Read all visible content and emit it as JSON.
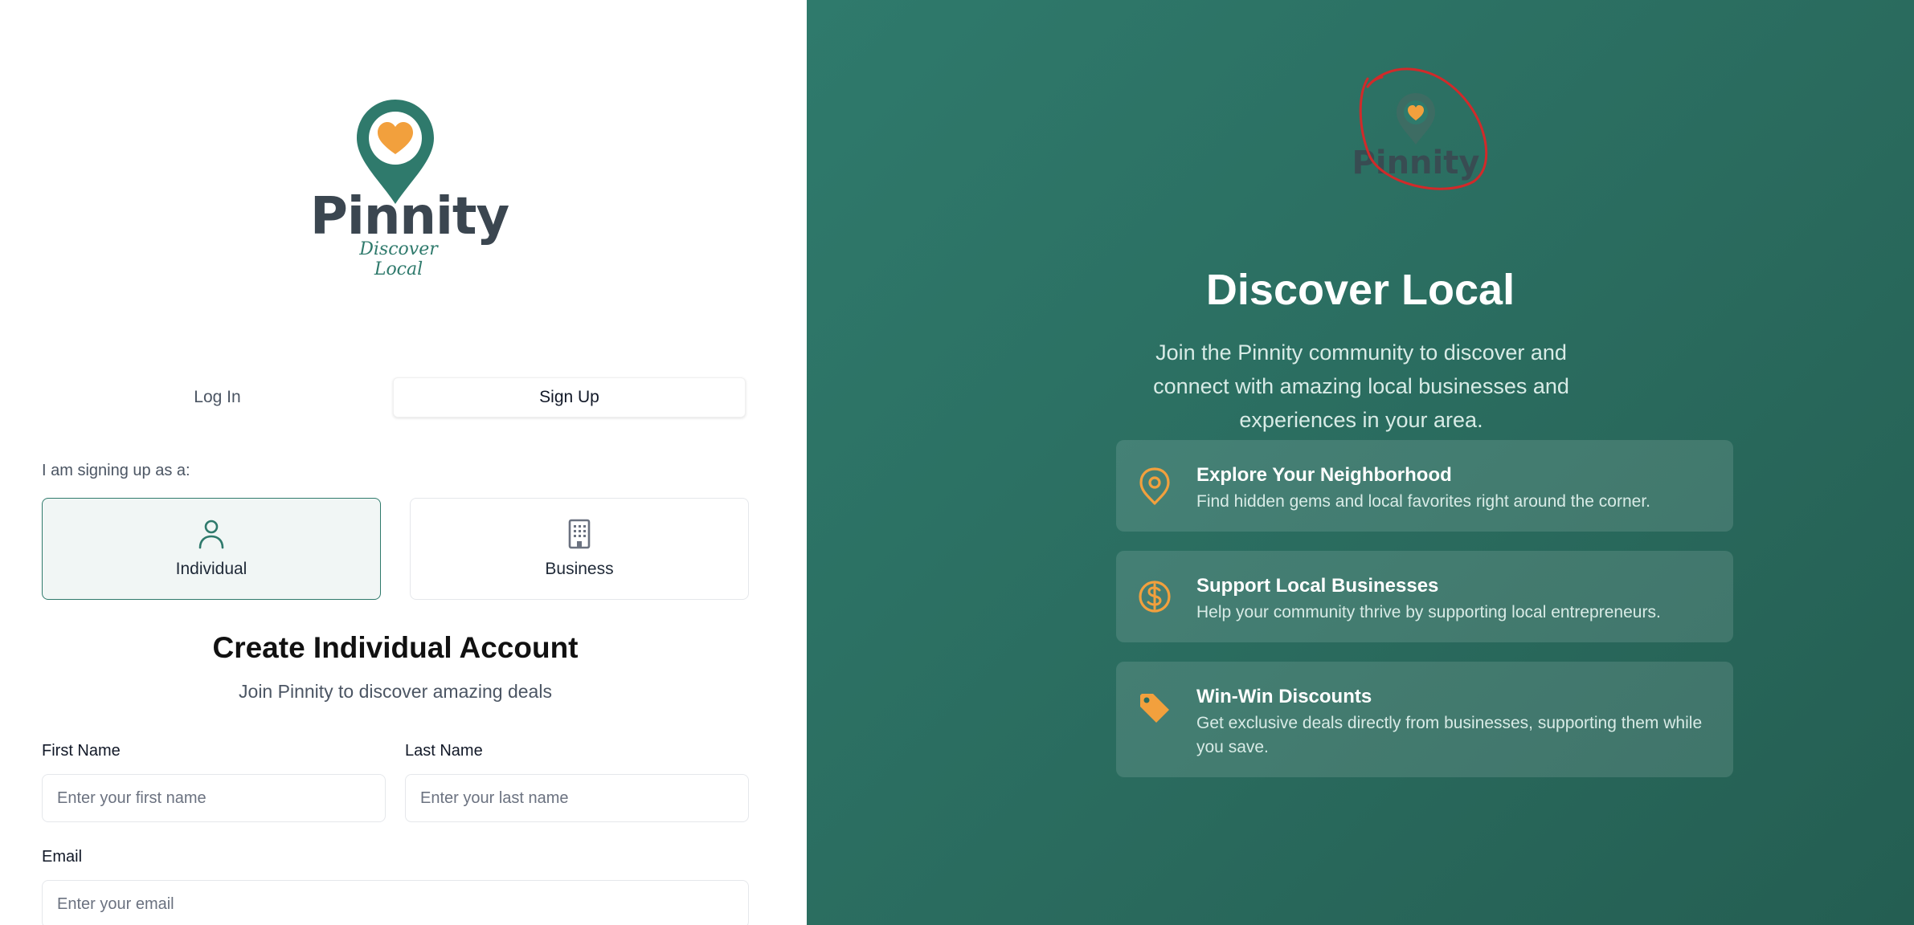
{
  "brand": {
    "name": "Pinnity",
    "tagline": "Discover Local",
    "colors": {
      "primary": "#2f7a6c",
      "accent": "#f2a03d",
      "text": "#3b4650",
      "annotation": "#d12a2a"
    }
  },
  "auth_tabs": {
    "login_label": "Log In",
    "signup_label": "Sign Up",
    "active": "signup"
  },
  "signup": {
    "role_prompt": "I am signing up as a:",
    "roles": [
      {
        "label": "Individual",
        "icon": "user-icon",
        "selected": true
      },
      {
        "label": "Business",
        "icon": "building-icon",
        "selected": false
      }
    ],
    "title": "Create Individual Account",
    "subtitle": "Join Pinnity to discover amazing deals",
    "fields": {
      "first_name": {
        "label": "First Name",
        "placeholder": "Enter your first name",
        "value": ""
      },
      "last_name": {
        "label": "Last Name",
        "placeholder": "Enter your last name",
        "value": ""
      },
      "email": {
        "label": "Email",
        "placeholder": "Enter your email",
        "value": ""
      }
    }
  },
  "hero": {
    "logo_word": "Pinnity",
    "title": "Discover Local",
    "description": "Join the Pinnity community to discover and connect with amazing local businesses and experiences in your area.",
    "features": [
      {
        "icon": "map-pin-icon",
        "title": "Explore Your Neighborhood",
        "description": "Find hidden gems and local favorites right around the corner."
      },
      {
        "icon": "dollar-circle-icon",
        "title": "Support Local Businesses",
        "description": "Help your community thrive by supporting local entrepreneurs."
      },
      {
        "icon": "tag-icon",
        "title": "Win-Win Discounts",
        "description": "Get exclusive deals directly from businesses, supporting them while you save."
      }
    ]
  }
}
